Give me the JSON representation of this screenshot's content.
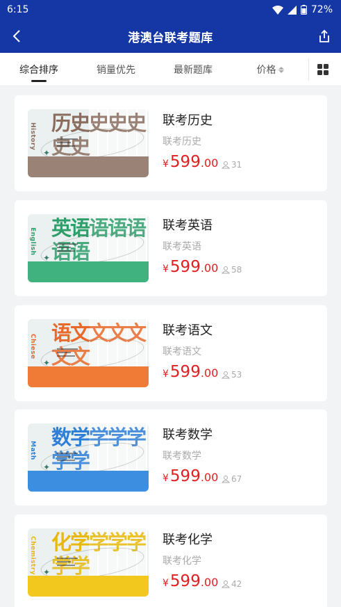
{
  "status_bar": {
    "time": "6:15",
    "battery": "72%"
  },
  "app_bar": {
    "title": "港澳台联考题库"
  },
  "sort_tabs": [
    {
      "label": "综合排序",
      "active": true
    },
    {
      "label": "销量优先",
      "active": false
    },
    {
      "label": "最新题库",
      "active": false
    },
    {
      "label": "价格",
      "active": false
    }
  ],
  "accent_color": "#1537a6",
  "price_color": "#e02020",
  "products": [
    {
      "title": "联考历史",
      "subtitle": "联考历史",
      "currency": "¥",
      "price_int": "599",
      "price_dec": ".00",
      "sales": "31",
      "cover_big": "历史",
      "cover_big_extra": "史史史史史",
      "cover_eng": "History",
      "cover_color": "#9a8276",
      "cover_text_color": "#8a6d5f"
    },
    {
      "title": "联考英语",
      "subtitle": "联考英语",
      "currency": "¥",
      "price_int": "599",
      "price_dec": ".00",
      "sales": "58",
      "cover_big": "英语",
      "cover_big_extra": "语语语语语",
      "cover_eng": "English",
      "cover_color": "#3fb27f",
      "cover_text_color": "#2e9e6b"
    },
    {
      "title": "联考语文",
      "subtitle": "联考语文",
      "currency": "¥",
      "price_int": "599",
      "price_dec": ".00",
      "sales": "53",
      "cover_big": "语文",
      "cover_big_extra": "文文文文文",
      "cover_eng": "Chiese",
      "cover_color": "#ef7b36",
      "cover_text_color": "#e9692a"
    },
    {
      "title": "联考数学",
      "subtitle": "联考数学",
      "currency": "¥",
      "price_int": "599",
      "price_dec": ".00",
      "sales": "67",
      "cover_big": "数学",
      "cover_big_extra": "学学学学学",
      "cover_eng": "Math",
      "cover_color": "#3b8ee0",
      "cover_text_color": "#2f7fd6"
    },
    {
      "title": "联考化学",
      "subtitle": "联考化学",
      "currency": "¥",
      "price_int": "599",
      "price_dec": ".00",
      "sales": "42",
      "cover_big": "化学",
      "cover_big_extra": "学学学学学",
      "cover_eng": "Chemistry",
      "cover_color": "#f2c81e",
      "cover_text_color": "#e8b90c"
    }
  ]
}
